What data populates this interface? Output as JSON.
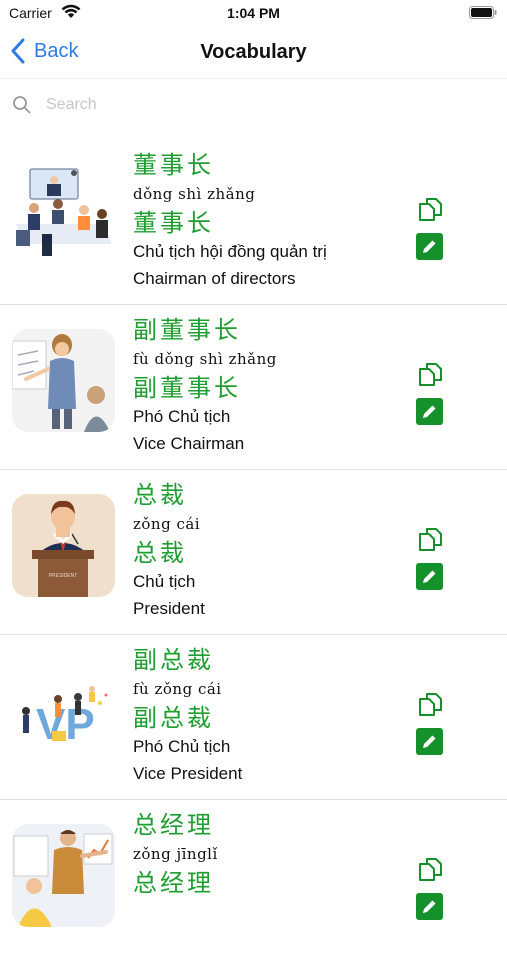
{
  "status_bar": {
    "carrier": "Carrier",
    "time": "1:04 PM"
  },
  "nav": {
    "back_label": "Back",
    "title": "Vocabulary"
  },
  "search": {
    "placeholder": "Search",
    "value": ""
  },
  "accent_colors": {
    "link_blue": "#2f7ae5",
    "hanzi_green": "#1e9e2f",
    "button_green": "#14912a"
  },
  "items": [
    {
      "hanzi": "董事长",
      "pinyin": "dǒng shì zhǎng",
      "hanzi_repeat": "董事长",
      "vietnamese": "Chủ tịch hội đồng quản trị",
      "english": "Chairman of directors",
      "image": "meeting-room-illustration"
    },
    {
      "hanzi": "副董事长",
      "pinyin": "fù dǒng shì zhǎng",
      "hanzi_repeat": "副董事长",
      "vietnamese": "Phó Chủ tịch",
      "english": "Vice Chairman",
      "image": "presenter-illustration"
    },
    {
      "hanzi": "总裁",
      "pinyin": "zǒng cái",
      "hanzi_repeat": "总裁",
      "vietnamese": "Chủ tịch",
      "english": "President",
      "image": "president-podium-illustration",
      "podium_text": "PRESIDENT"
    },
    {
      "hanzi": "副总裁",
      "pinyin": "fù zǒng cái",
      "hanzi_repeat": "副总裁",
      "vietnamese": "Phó Chủ tịch",
      "english": "Vice President",
      "image": "vp-letters-illustration",
      "badge_text": "VP"
    },
    {
      "hanzi": "总经理",
      "pinyin": "zǒng jīnglǐ",
      "hanzi_repeat": "总经理",
      "vietnamese": "",
      "english": "",
      "image": "manager-illustration"
    }
  ]
}
